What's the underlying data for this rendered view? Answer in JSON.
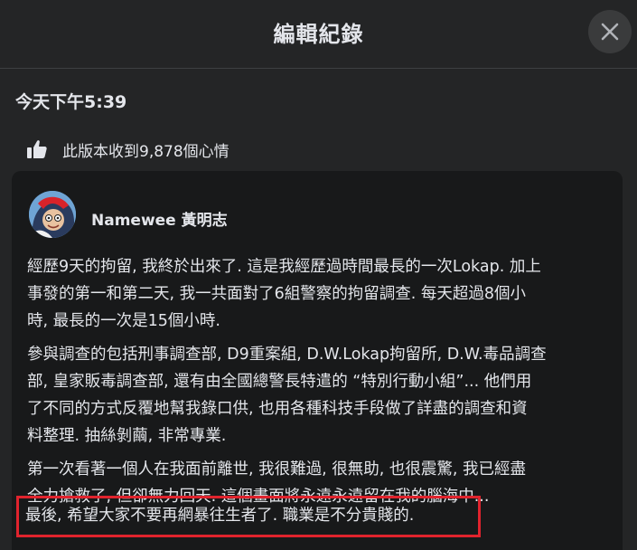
{
  "header": {
    "title": "編輯紀錄",
    "close_icon": "close-icon"
  },
  "timestamp": "今天下午5:39",
  "reactions": {
    "text": "此版本收到9,878個心情",
    "icon": "thumbs-up-icon"
  },
  "post": {
    "author": "Namewee 黃明志",
    "lines": [
      "經歷9天的拘留, 我終於出來了. 這是我經歷過時間最長的一次Lokap. 加上",
      "事發的第一和第二天, 我一共面對了6組警察的拘留調查. 每天超過8個小",
      "時, 最長的一次是15個小時.",
      "參與調查的包括刑事調查部, D9重案組, D.W.Lokap拘留所, D.W.毒品調查",
      "部, 皇家販毒調查部, 還有由全國總警長特遣的 “特別行動小組”... 他們用",
      "了不同的方式反覆地幫我錄口供, 也用各種科技手段做了詳盡的調查和資",
      "料整理. 抽絲剝繭, 非常專業.",
      "第一次看著一個人在我面前離世, 我很難過, 很無助, 也很震驚, 我已經盡",
      "全力搶救了, 但卻無力回天. 這個畫面將永遠永遠留在我的腦海中...",
      "最後, 希望大家不要再網暴往生者了. 職業是不分貴賤的."
    ]
  },
  "colors": {
    "background": "#242526",
    "card": "#18191a",
    "highlight": "#e0232d"
  }
}
